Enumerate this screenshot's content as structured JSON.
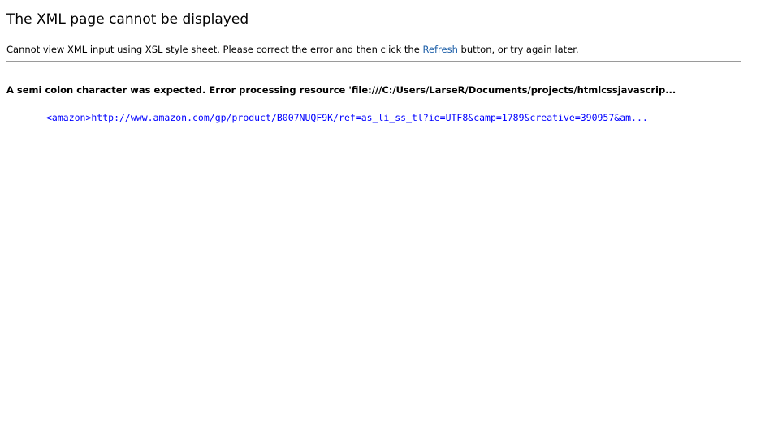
{
  "error_page": {
    "title": "The XML page cannot be displayed",
    "message": {
      "before_link": "Cannot view XML input using XSL style sheet. Please correct the error and then click the ",
      "link_label": "Refresh",
      "after_link": " button, or try again later."
    },
    "error_heading": "A semi colon character was expected. Error processing resource 'file:///C:/Users/LarseR/Documents/projects/htmlcssjavascrip...",
    "source_line": "<amazon>http://www.amazon.com/gp/product/B007NUQF9K/ref=as_li_ss_tl?ie=UTF8&camp=1789&creative=390957&am..."
  }
}
